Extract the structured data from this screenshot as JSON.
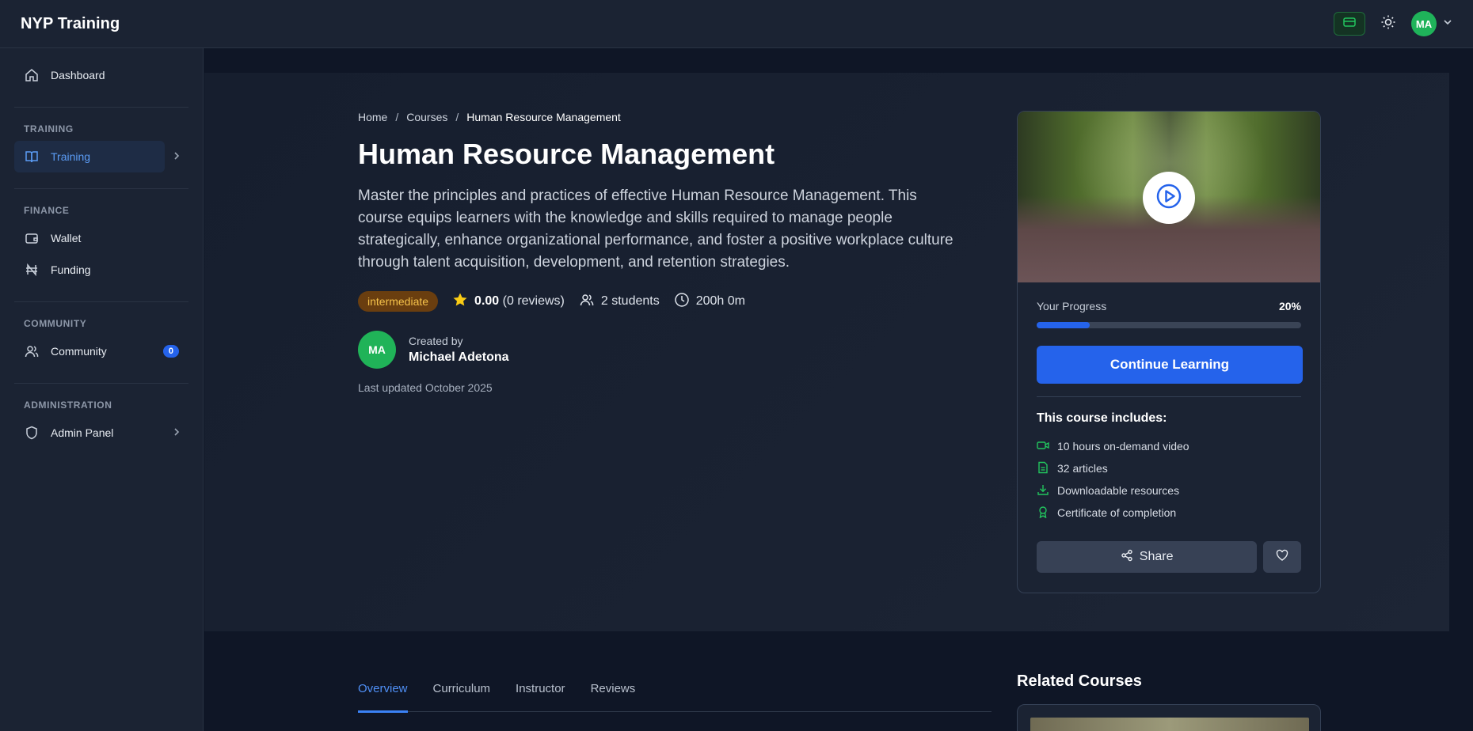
{
  "app": {
    "title": "NYP Training"
  },
  "header": {
    "wallet_icon": "wallet-card-icon",
    "theme_icon": "sun-icon",
    "user_initials": "MA",
    "chevron_icon": "chevron-down-icon"
  },
  "sidebar": {
    "dashboard": {
      "label": "Dashboard",
      "icon": "home-icon"
    },
    "sections": [
      {
        "title": "TRAINING",
        "items": [
          {
            "label": "Training",
            "icon": "book-icon",
            "active": true
          }
        ]
      },
      {
        "title": "FINANCE",
        "items": [
          {
            "label": "Wallet",
            "icon": "wallet-icon"
          },
          {
            "label": "Funding",
            "icon": "naira-icon"
          }
        ]
      },
      {
        "title": "COMMUNITY",
        "items": [
          {
            "label": "Community",
            "icon": "users-icon",
            "badge": "0"
          }
        ]
      },
      {
        "title": "ADMINISTRATION",
        "items": [
          {
            "label": "Admin Panel",
            "icon": "shield-icon"
          }
        ]
      }
    ]
  },
  "course": {
    "breadcrumb": [
      "Home",
      "Courses",
      "Human Resource Management"
    ],
    "breadcrumb_sep": "/",
    "title": "Human Resource Management",
    "description": "Master the principles and practices of effective Human Resource Management. This course equips learners with the knowledge and skills required to manage people strategically, enhance organizational performance, and foster a positive workplace culture through talent acquisition, development, and retention strategies.",
    "level": "intermediate",
    "rating": "0.00",
    "reviews": "(0 reviews)",
    "students": "2 students",
    "duration": "200h 0m",
    "creator_initials": "MA",
    "creator_label": "Created by",
    "creator_name": "Michael Adetona",
    "last_updated": "Last updated October 2025"
  },
  "card": {
    "progress_label": "Your Progress",
    "progress_value": "20%",
    "progress_fraction": 0.2,
    "cta": "Continue Learning",
    "includes_title": "This course includes:",
    "includes": [
      {
        "icon": "video-icon",
        "label": "10 hours on-demand video"
      },
      {
        "icon": "file-text-icon",
        "label": "32 articles"
      },
      {
        "icon": "download-icon",
        "label": "Downloadable resources"
      },
      {
        "icon": "award-icon",
        "label": "Certificate of completion"
      }
    ],
    "share": "Share"
  },
  "tabs": [
    "Overview",
    "Curriculum",
    "Instructor",
    "Reviews"
  ],
  "related": {
    "title": "Related Courses"
  },
  "colors": {
    "accent": "#2563eb",
    "success": "#22c55e",
    "level_bg": "#6a3e0f",
    "level_fg": "#f5c24a"
  }
}
